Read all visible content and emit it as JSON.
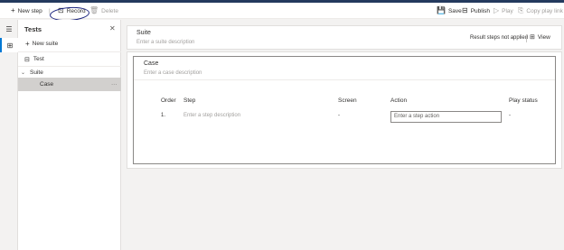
{
  "toolbar": {
    "new_step": "New step",
    "record": "Record",
    "delete": "Delete",
    "save": "Save",
    "publish": "Publish",
    "play": "Play",
    "copy_play_link": "Copy play link"
  },
  "tree": {
    "title": "Tests",
    "new_suite": "New suite",
    "test": "Test",
    "suite": "Suite",
    "case": "Case",
    "more": "···"
  },
  "suite": {
    "name": "Suite",
    "description_placeholder": "Enter a suite description",
    "result_status": "Result steps not applied",
    "view": "View"
  },
  "case": {
    "name": "Case",
    "description_placeholder": "Enter a case description",
    "columns": {
      "order": "Order",
      "step": "Step",
      "screen": "Screen",
      "action": "Action",
      "play_status": "Play status"
    },
    "rows": [
      {
        "order": "1.",
        "step_placeholder": "Enter a step description",
        "screen": "-",
        "action_placeholder": "Enter a step action",
        "play_status": "-"
      }
    ]
  }
}
